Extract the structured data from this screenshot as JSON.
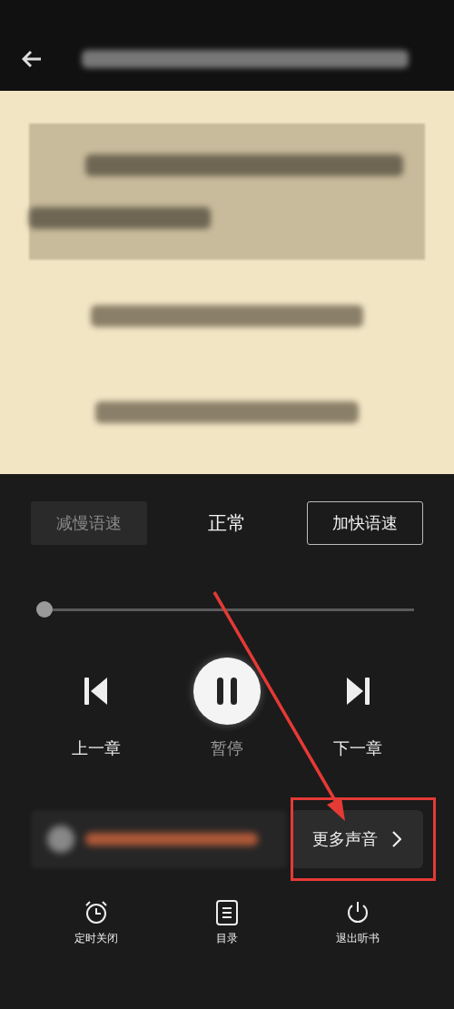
{
  "speed": {
    "slower": {
      "label": "减慢语速",
      "disabled": true
    },
    "current": "正常",
    "faster": {
      "label": "加快语速",
      "disabled": false
    }
  },
  "progress": {
    "level": 0
  },
  "playback": [
    {
      "kind": "previous",
      "label": "上一章"
    },
    {
      "kind": "pause",
      "label": "暂停"
    },
    {
      "kind": "next",
      "label": "下一章"
    }
  ],
  "voice": {
    "more_button": "更多声音"
  },
  "tools": [
    {
      "kind": "timer",
      "label": "定时关闭"
    },
    {
      "kind": "contents",
      "label": "目录"
    },
    {
      "kind": "exit",
      "label": "退出听书"
    }
  ]
}
